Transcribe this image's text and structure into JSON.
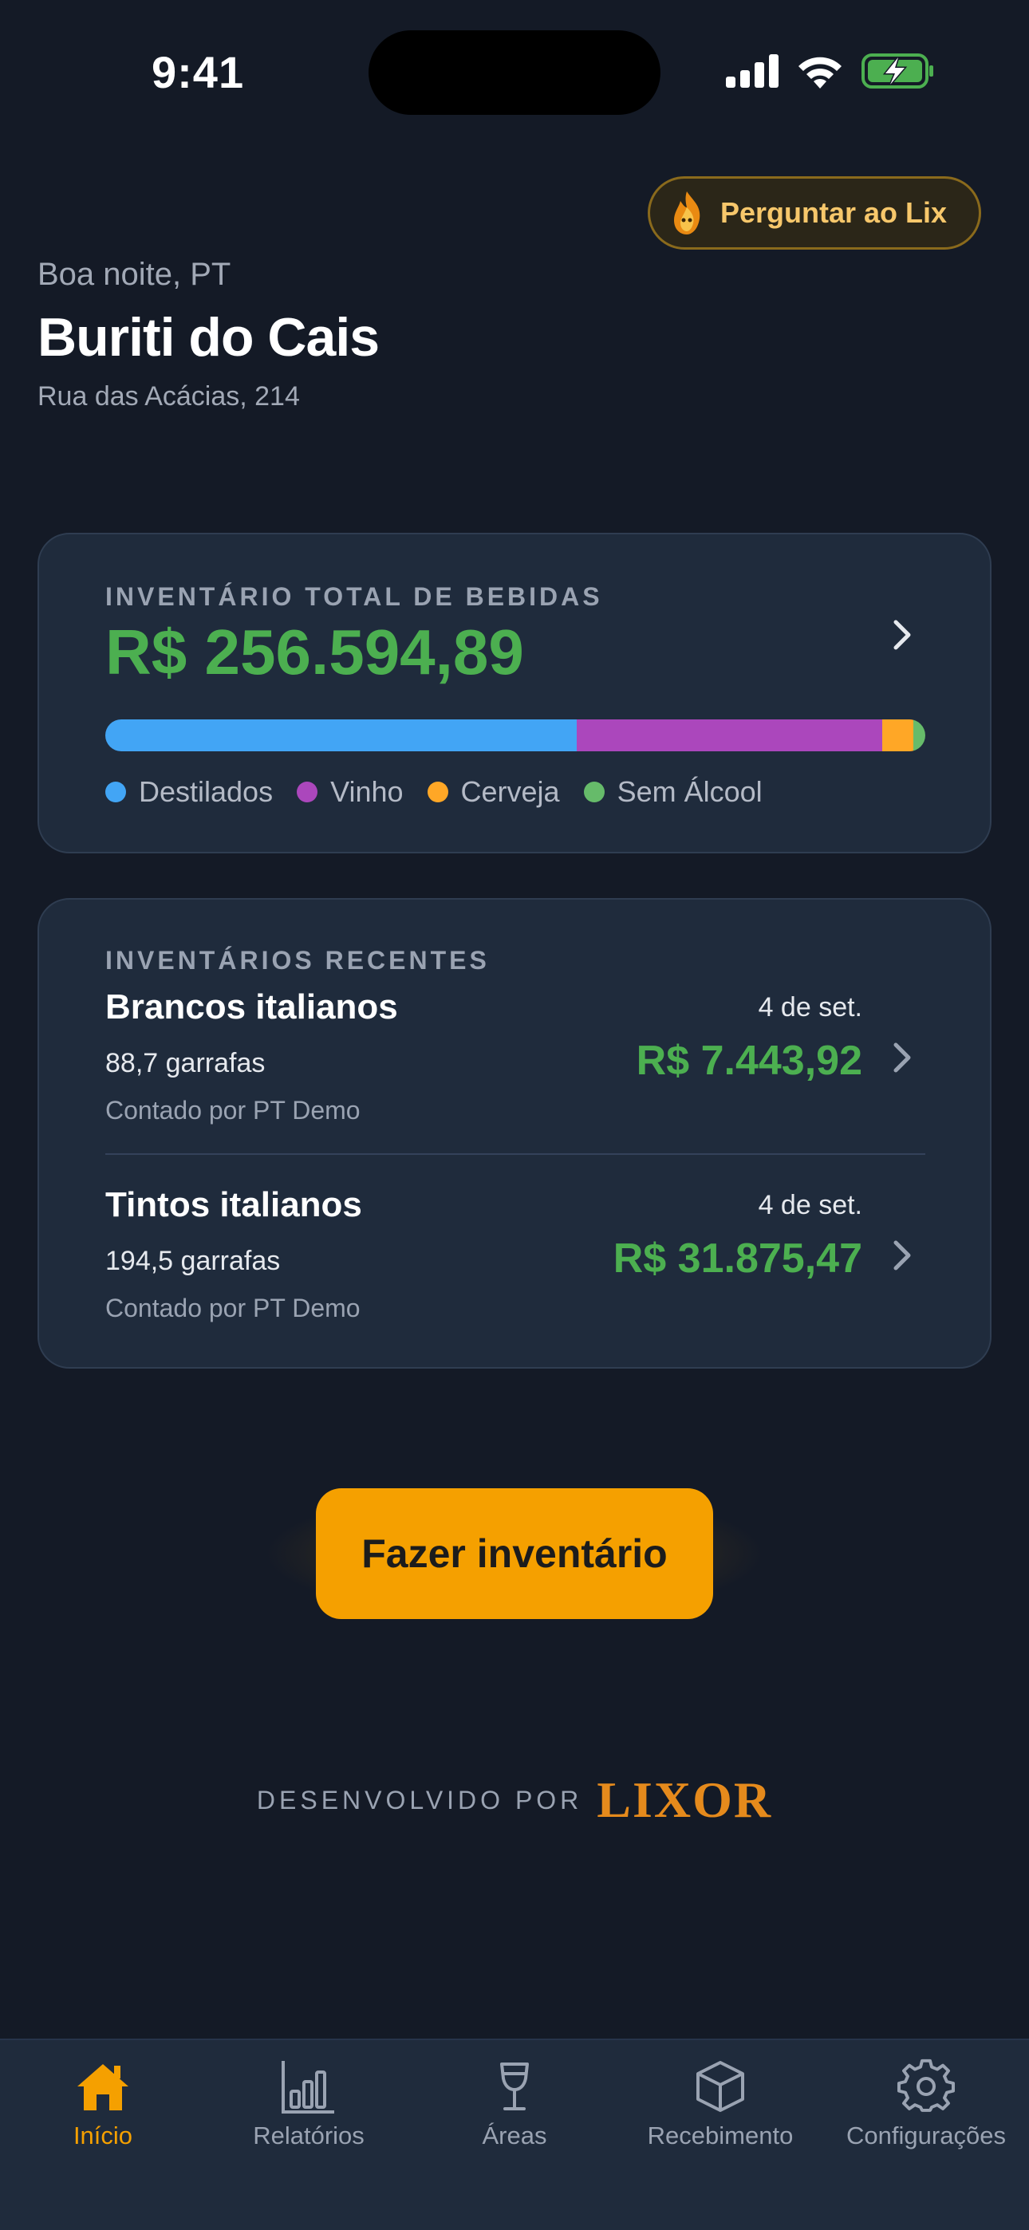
{
  "status_bar": {
    "time": "9:41"
  },
  "ask_button": {
    "label": "Perguntar ao Lix"
  },
  "header": {
    "greeting": "Boa noite, PT",
    "venue": "Buriti do Cais",
    "address": "Rua das Acácias, 214"
  },
  "total_inventory": {
    "label": "INVENTÁRIO TOTAL DE BEBIDAS",
    "value": "R$ 256.594,89",
    "segments": [
      {
        "name": "Destilados",
        "share": 0.575,
        "color": "#42a5f5"
      },
      {
        "name": "Vinho",
        "share": 0.372,
        "color": "#ab47bc"
      },
      {
        "name": "Cerveja",
        "share": 0.038,
        "color": "#ffa726"
      },
      {
        "name": "Sem Álcool",
        "share": 0.015,
        "color": "#66bb6a"
      }
    ]
  },
  "recent": {
    "label": "INVENTÁRIOS RECENTES",
    "items": [
      {
        "name": "Brancos italianos",
        "bottles": "88,7 garrafas",
        "counted_by": "Contado por PT Demo",
        "date": "4 de set.",
        "value": "R$ 7.443,92"
      },
      {
        "name": "Tintos italianos",
        "bottles": "194,5 garrafas",
        "counted_by": "Contado por PT Demo",
        "date": "4 de set.",
        "value": "R$ 31.875,47"
      }
    ]
  },
  "cta": {
    "label": "Fazer inventário"
  },
  "footer": {
    "developed_by": "DESENVOLVIDO POR",
    "brand": "LIXOR"
  },
  "tabs": [
    {
      "label": "Início",
      "icon": "home-icon",
      "active": true
    },
    {
      "label": "Relatórios",
      "icon": "bar-chart-icon",
      "active": false
    },
    {
      "label": "Áreas",
      "icon": "wine-glass-icon",
      "active": false
    },
    {
      "label": "Recebimento",
      "icon": "box-icon",
      "active": false
    },
    {
      "label": "Configurações",
      "icon": "gear-icon",
      "active": false
    }
  ],
  "colors": {
    "accent": "#f5a000",
    "positive": "#4caf50",
    "background": "#141a26",
    "card": "#1f2b3c"
  }
}
